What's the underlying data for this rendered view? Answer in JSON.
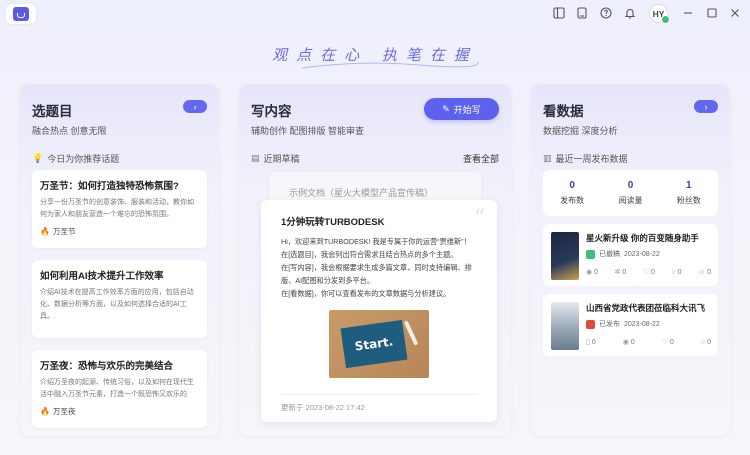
{
  "titlebar": {
    "avatar_initials": "HY",
    "icons": [
      "sidebar-icon",
      "tablet-icon",
      "help-icon",
      "bell-icon",
      "minimize-icon",
      "maximize-icon",
      "close-icon"
    ]
  },
  "slogan": "观点在心 执笔在握",
  "topics": {
    "title": "选题目",
    "subtitle": "融合热点 创意无限",
    "section": "今日为你推荐话题",
    "items": [
      {
        "title": "万圣节：如何打造独特恐怖氛围?",
        "desc": "分享一份万圣节的创意装饰、服装和活动，教你如何为家人和朋友营造一个难忘的恐怖氛围。",
        "tag": "万圣节"
      },
      {
        "title": "如何利用AI技术提升工作效率",
        "desc": "介绍AI技术在提高工作效率方面的应用，包括自动化、数据分析等方面，以及如何选择合适的AI工具。",
        "tag": ""
      },
      {
        "title": "万圣夜：恐怖与欢乐的完美结合",
        "desc": "介绍万圣夜的起源、传统习俗，以及如何在现代生活中融入万圣节元素，打造一个既恐怖又欢乐的",
        "tag": "万圣夜"
      }
    ]
  },
  "write": {
    "title": "写内容",
    "subtitle": "辅助创作 配图排版 智能审查",
    "button": "开始写",
    "section": "近期草稿",
    "view_all": "查看全部",
    "back_draft_title": "示例文档（星火大模型产品宣传稿）",
    "draft_title": "1分钟玩转TURBODESK",
    "draft_body": [
      "Hi，欢迎来到TURBODESK! 我是专属于你的运营“贾维斯”！",
      "在[选题目]，我会列出符合需求且结合热点的多个主题。",
      "在[写内容]，我会根据要求生成多篇文章，同时支持编辑、排版、AI配图和分发到多平台。",
      "在[看数据]，你可以查看发布的文章数据与分析建议。"
    ],
    "image_text": "Start.",
    "updated": "更新于 2023-08-22 17:42"
  },
  "data": {
    "title": "看数据",
    "subtitle": "数据挖掘 深度分析",
    "section": "最近一周发布数据",
    "stats": [
      {
        "value": "0",
        "label": "发布数"
      },
      {
        "value": "0",
        "label": "阅读量"
      },
      {
        "value": "1",
        "label": "粉丝数"
      }
    ],
    "articles": [
      {
        "title": "星火新升级 你的百变随身助手",
        "source": "已撤稿",
        "date": "2023-08-22",
        "nums": [
          "0",
          "0",
          "0",
          "0",
          "0"
        ]
      },
      {
        "title": "山西省党政代表团莅临科大讯飞",
        "source": "已发布",
        "date": "2023-08-22",
        "nums": [
          "0",
          "0",
          "0",
          "0"
        ]
      }
    ]
  },
  "colors": {
    "accent": "#5d62ee",
    "stat_value": "#3a3fb0",
    "bg": "#f3f3fb"
  }
}
